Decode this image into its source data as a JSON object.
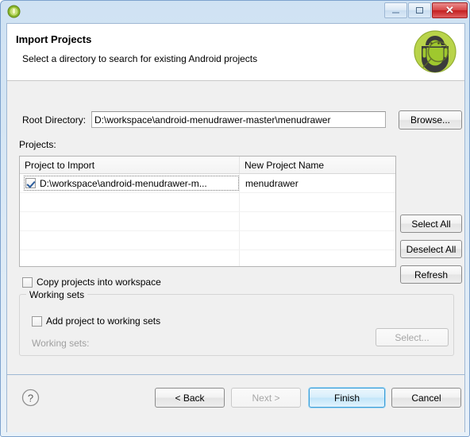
{
  "window": {
    "app_icon": "eclipse-icon",
    "controls": {
      "minimize": "minimize-icon",
      "maximize": "maximize-icon",
      "close_label": "✕"
    }
  },
  "header": {
    "title": "Import Projects",
    "description": "Select a directory to search for existing Android projects",
    "logo": "android-logo-icon"
  },
  "form": {
    "root_directory_label": "Root Directory:",
    "root_directory_value": "D:\\workspace\\android-menudrawer-master\\menudrawer",
    "root_directory_placeholder": "",
    "browse_label": "Browse...",
    "projects_label": "Projects:"
  },
  "table": {
    "columns": [
      "Project to Import",
      "New Project Name"
    ],
    "rows": [
      {
        "checked": true,
        "project_to_import": "D:\\workspace\\android-menudrawer-m...",
        "new_project_name": "menudrawer",
        "focused": true
      }
    ],
    "empty_row_count": 4
  },
  "side_buttons": {
    "select_all": "Select All",
    "deselect_all": "Deselect All",
    "refresh": "Refresh"
  },
  "options": {
    "copy_projects_label": "Copy projects into workspace",
    "copy_projects_checked": false
  },
  "working_sets": {
    "group_title": "Working sets",
    "add_project_label": "Add project to working sets",
    "add_project_checked": false,
    "combo_label": "Working sets:",
    "combo_value": "",
    "combo_disabled": true,
    "select_label": "Select...",
    "select_disabled": true
  },
  "footer": {
    "help_icon": "help-icon",
    "back_label": "< Back",
    "next_label": "Next >",
    "next_disabled": true,
    "finish_label": "Finish",
    "finish_is_default": true,
    "cancel_label": "Cancel"
  },
  "colors": {
    "accent": "#3c9cd6",
    "frame": "#7da2ce",
    "close_button": "#c32020",
    "android_green": "#a4c639",
    "body_bg": "#f0f0f0"
  }
}
